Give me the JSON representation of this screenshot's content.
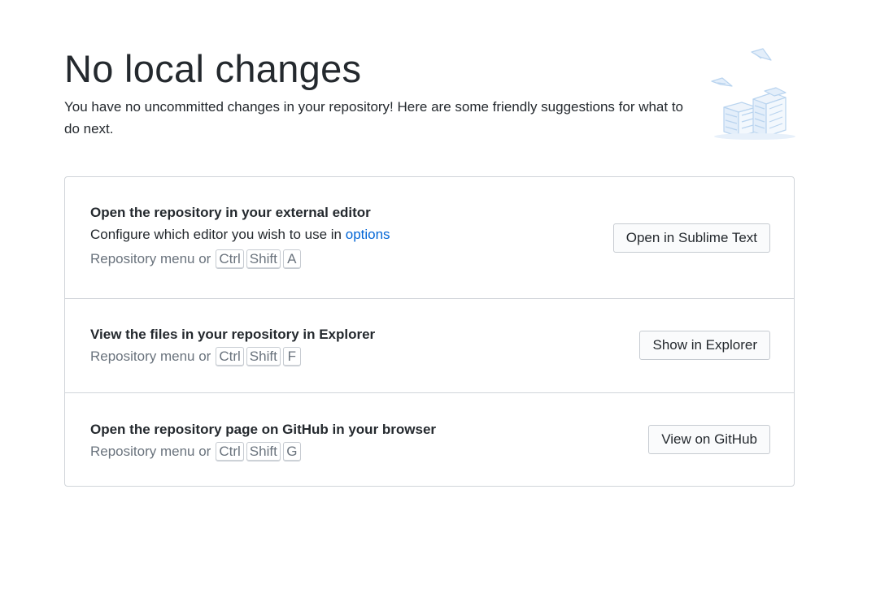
{
  "header": {
    "title": "No local changes",
    "subtitle": "You have no uncommitted changes in your repository! Here are some friendly suggestions for what to do next."
  },
  "illustration": {
    "icon": "paper-stack-illustration",
    "color": "#cfe2f6"
  },
  "actions": [
    {
      "title": "Open the repository in your external editor",
      "description_prefix": "Configure which editor you wish to use in ",
      "description_link": "options",
      "shortcut_prefix": "Repository menu or",
      "keys": [
        "Ctrl",
        "Shift",
        "A"
      ],
      "button_label": "Open in Sublime Text"
    },
    {
      "title": "View the files in your repository in Explorer",
      "shortcut_prefix": "Repository menu or",
      "keys": [
        "Ctrl",
        "Shift",
        "F"
      ],
      "button_label": "Show in Explorer"
    },
    {
      "title": "Open the repository page on GitHub in your browser",
      "shortcut_prefix": "Repository menu or",
      "keys": [
        "Ctrl",
        "Shift",
        "G"
      ],
      "button_label": "View on GitHub"
    }
  ],
  "colors": {
    "text": "#24292e",
    "muted": "#6a737d",
    "link": "#0366d6",
    "border": "#d1d5da",
    "button_bg": "#fafbfc"
  }
}
